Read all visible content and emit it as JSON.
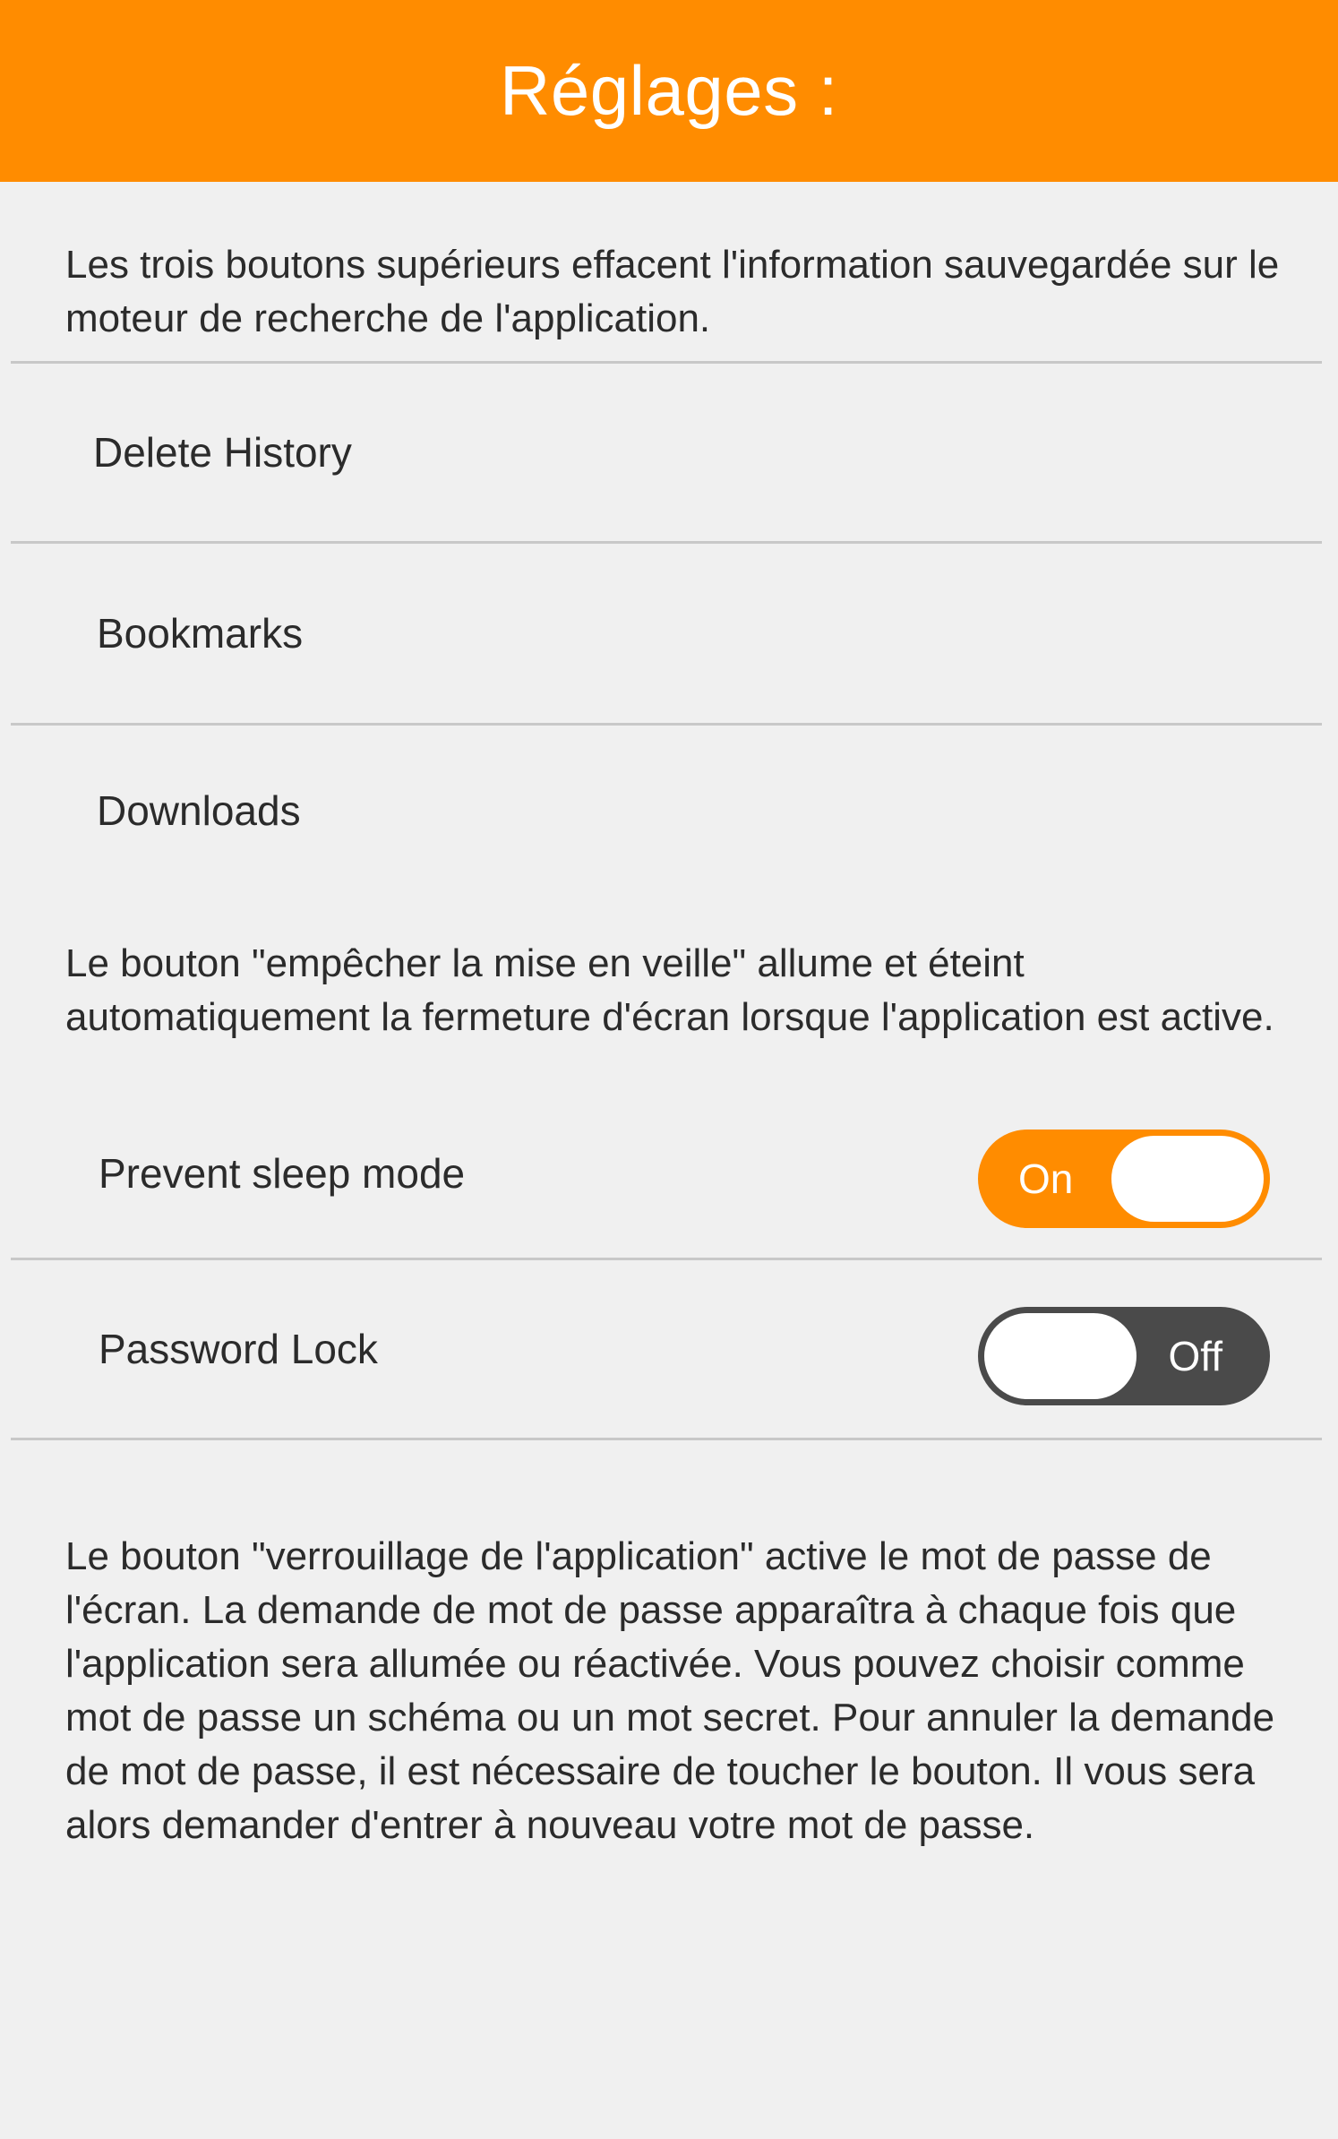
{
  "header": {
    "title": "Réglages :"
  },
  "intro_text": "Les trois boutons supérieurs effacent l'information sauvegardée sur le moteur de recherche de l'application.",
  "clear_items": [
    {
      "label": "Delete History"
    },
    {
      "label": "Bookmarks"
    },
    {
      "label": "Downloads"
    }
  ],
  "sleep_info_text": "Le bouton \"empêcher la mise en veille\" allume et éteint automatiquement la fermeture d'écran lorsque l'application est active.",
  "toggles": {
    "prevent_sleep": {
      "label": "Prevent sleep mode",
      "state_text": "On",
      "checked": true
    },
    "password_lock": {
      "label": "Password Lock",
      "state_text": "Off",
      "checked": false
    }
  },
  "lock_info_text": "Le bouton \"verrouillage de l'application\" active le mot de passe de l'écran. La demande de mot de passe apparaîtra à chaque fois que l'application sera allumée ou réactivée. Vous pouvez choisir comme mot de passe un schéma ou un mot secret. Pour annuler la demande de mot de passe, il est nécessaire de toucher le bouton. Il vous sera alors demander d'entrer à nouveau votre mot de passe.",
  "colors": {
    "accent": "#ff8c00",
    "background": "#f0f0f0",
    "toggle_off": "#4a4a4a",
    "divider": "#c8c8c8"
  }
}
